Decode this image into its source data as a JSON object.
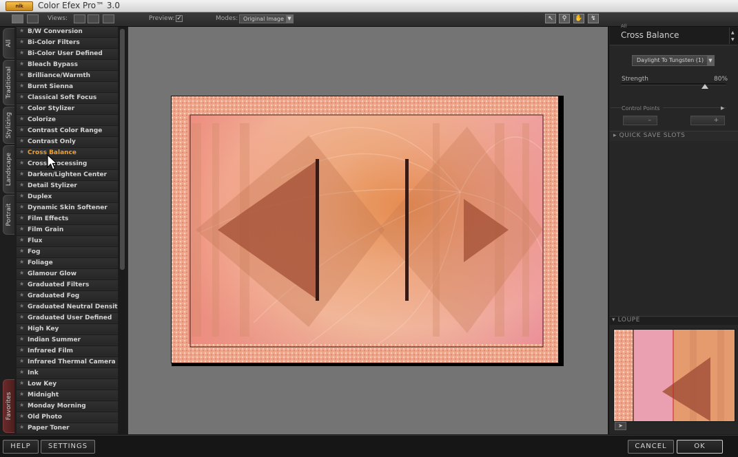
{
  "app": {
    "logo_text": "nik",
    "title": "Color Efex Pro™ 3.0"
  },
  "toolbar": {
    "views_label": "Views:",
    "preview_label": "Preview:",
    "preview_checked": true,
    "preview_check_glyph": "✓",
    "modes_label": "Modes:",
    "modes_value": "Original Image"
  },
  "categories": [
    "All",
    "Traditional",
    "Stylizing",
    "Landscape",
    "Portrait",
    "Favorites"
  ],
  "filters": [
    "B/W Conversion",
    "Bi-Color Filters",
    "Bi-Color User Defined",
    "Bleach Bypass",
    "Brilliance/Warmth",
    "Burnt Sienna",
    "Classical Soft Focus",
    "Color Stylizer",
    "Colorize",
    "Contrast Color Range",
    "Contrast Only",
    "Cross Balance",
    "Cross Processing",
    "Darken/Lighten Center",
    "Detail Stylizer",
    "Duplex",
    "Dynamic Skin Softener",
    "Film Effects",
    "Film Grain",
    "Flux",
    "Fog",
    "Foliage",
    "Glamour Glow",
    "Graduated Filters",
    "Graduated Fog",
    "Graduated Neutral Density",
    "Graduated User Defined",
    "High Key",
    "Indian Summer",
    "Infrared Film",
    "Infrared Thermal Camera",
    "Ink",
    "Low Key",
    "Midnight",
    "Monday Morning",
    "Old Photo",
    "Paper Toner"
  ],
  "selected_filter": "Cross Balance",
  "panel": {
    "category": "All",
    "filter_name": "Cross Balance",
    "method": "Daylight To Tungsten (1)",
    "strength_label": "Strength",
    "strength_value": "80%",
    "strength_fraction": 0.8,
    "control_points_label": "Control Points",
    "quick_save_label": "QUICK SAVE SLOTS",
    "loupe_label": "LOUPE"
  },
  "buttons": {
    "help": "HELP",
    "settings": "SETTINGS",
    "cancel": "CANCEL",
    "ok": "OK"
  },
  "colors": {
    "selected_item": "#f0a030",
    "image_base": "#e8a080",
    "image_pink": "#e890a0",
    "image_orange": "#e07a30"
  }
}
